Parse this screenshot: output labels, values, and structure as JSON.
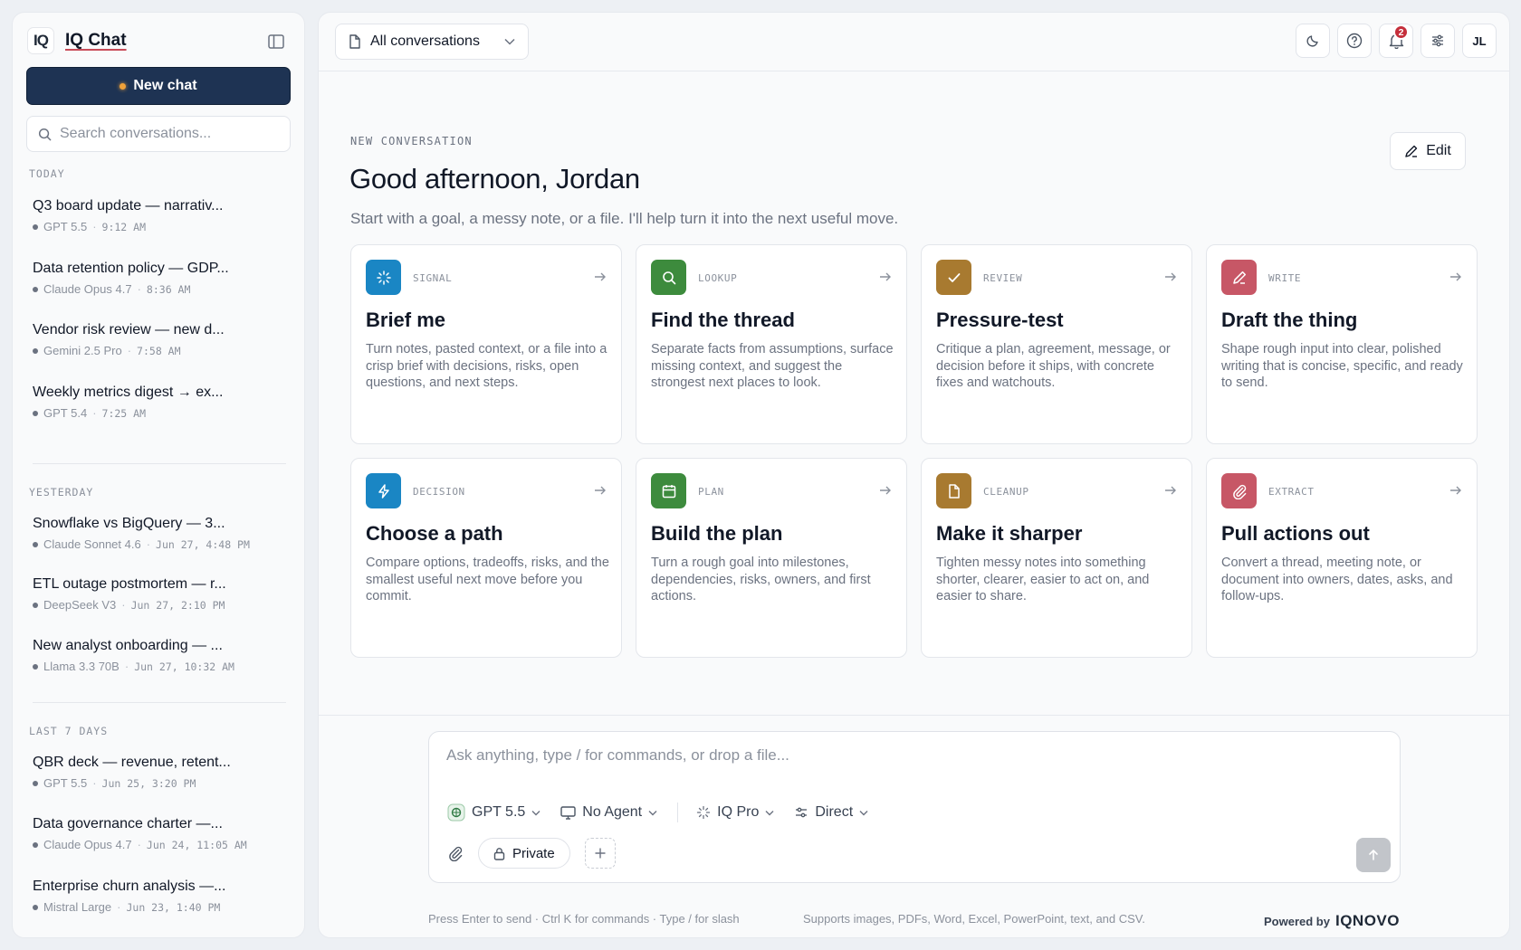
{
  "sidebar": {
    "brand_logo": "IQ",
    "brand_name": "IQ Chat",
    "new_chat_label": "New chat",
    "search_placeholder": "Search conversations...",
    "sections": [
      {
        "label": "TODAY",
        "items": [
          {
            "title": "Q3 board update — narrativ...",
            "model": "GPT 5.5",
            "time": "9:12 AM"
          },
          {
            "title": "Data retention policy — GDP...",
            "model": "Claude Opus 4.7",
            "time": "8:36 AM"
          },
          {
            "title": "Vendor risk review — new d...",
            "model": "Gemini 2.5 Pro",
            "time": "7:58 AM"
          },
          {
            "title": "Weekly metrics digest → ex...",
            "model": "GPT 5.4",
            "time": "7:25 AM"
          }
        ]
      },
      {
        "label": "YESTERDAY",
        "items": [
          {
            "title": "Snowflake vs BigQuery — 3...",
            "model": "Claude Sonnet 4.6",
            "time": "Jun 27, 4:48 PM"
          },
          {
            "title": "ETL outage postmortem — r...",
            "model": "DeepSeek V3",
            "time": "Jun 27, 2:10 PM"
          },
          {
            "title": "New analyst onboarding — ...",
            "model": "Llama 3.3 70B",
            "time": "Jun 27, 10:32 AM"
          }
        ]
      },
      {
        "label": "LAST 7 DAYS",
        "items": [
          {
            "title": "QBR deck — revenue, retent...",
            "model": "GPT 5.5",
            "time": "Jun 25, 3:20 PM"
          },
          {
            "title": "Data governance charter —...",
            "model": "Claude Opus 4.7",
            "time": "Jun 24, 11:05 AM"
          },
          {
            "title": "Enterprise churn analysis —...",
            "model": "Mistral Large",
            "time": "Jun 23, 1:40 PM"
          }
        ]
      }
    ]
  },
  "topbar": {
    "conversation_filter": "All conversations",
    "notification_count": "2",
    "avatar_initials": "JL"
  },
  "hero": {
    "eyebrow": "NEW CONVERSATION",
    "greeting": "Good afternoon, Jordan",
    "subtitle": "Start with a goal, a messy note, or a file. I'll help turn it into the next useful move.",
    "edit_label": "Edit"
  },
  "cards": [
    {
      "tag": "SIGNAL",
      "title": "Brief me",
      "desc": "Turn notes, pasted context, or a file into a crisp brief with decisions, risks, open questions, and next steps.",
      "color": "#1a86c4",
      "icon": "sparkle-icon"
    },
    {
      "tag": "LOOKUP",
      "title": "Find the thread",
      "desc": "Separate facts from assumptions, surface missing context, and suggest the strongest next places to look.",
      "color": "#3d8b3d",
      "icon": "search-icon"
    },
    {
      "tag": "REVIEW",
      "title": "Pressure-test",
      "desc": "Critique a plan, agreement, message, or decision before it ships, with concrete fixes and watchouts.",
      "color": "#a87a30",
      "icon": "check-icon"
    },
    {
      "tag": "WRITE",
      "title": "Draft the thing",
      "desc": "Shape rough input into clear, polished writing that is concise, specific, and ready to send.",
      "color": "#c75766",
      "icon": "pencil-icon"
    },
    {
      "tag": "DECISION",
      "title": "Choose a path",
      "desc": "Compare options, tradeoffs, risks, and the smallest useful next move before you commit.",
      "color": "#1a86c4",
      "icon": "bolt-icon"
    },
    {
      "tag": "PLAN",
      "title": "Build the plan",
      "desc": "Turn a rough goal into milestones, dependencies, risks, owners, and first actions.",
      "color": "#3d8b3d",
      "icon": "calendar-icon"
    },
    {
      "tag": "CLEANUP",
      "title": "Make it sharper",
      "desc": "Tighten messy notes into something shorter, clearer, easier to act on, and easier to share.",
      "color": "#a87a30",
      "icon": "document-icon"
    },
    {
      "tag": "EXTRACT",
      "title": "Pull actions out",
      "desc": "Convert a thread, meeting note, or document into owners, dates, asks, and follow-ups.",
      "color": "#c75766",
      "icon": "paperclip-icon"
    }
  ],
  "composer": {
    "placeholder": "Ask anything, type / for commands, or drop a file...",
    "model": "GPT 5.5",
    "agent": "No Agent",
    "tier": "IQ Pro",
    "mode": "Direct",
    "private_label": "Private"
  },
  "footer": {
    "hint": "Press Enter to send · Ctrl K for commands · Type / for slash",
    "supports": "Supports images, PDFs, Word, Excel, PowerPoint, text, and CSV.",
    "powered_by": "Powered by",
    "powered_logo": "IQNOVO"
  }
}
